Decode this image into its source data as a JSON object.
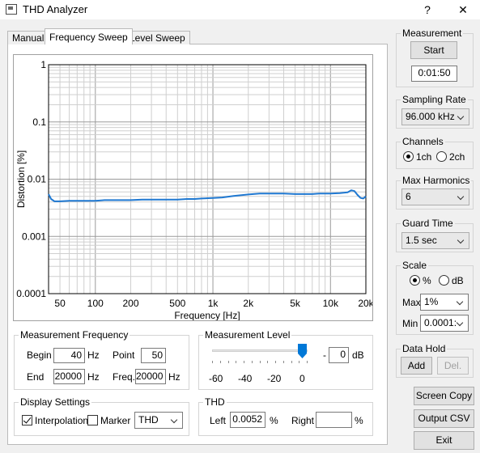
{
  "window": {
    "title": "THD Analyzer",
    "help_label": "?",
    "close_label": "✕"
  },
  "tabs": [
    {
      "label": "Manual",
      "active": false
    },
    {
      "label": "Frequency Sweep",
      "active": true
    },
    {
      "label": "Level Sweep",
      "active": false
    }
  ],
  "chart_data": {
    "type": "line",
    "xlabel": "Frequency [Hz]",
    "ylabel": "Distortion [%]",
    "x_scale": "log",
    "y_scale": "log",
    "xlim": [
      40,
      20000
    ],
    "ylim": [
      0.0001,
      1
    ],
    "grid": true,
    "x_ticks": [
      {
        "value": 50,
        "label": "50"
      },
      {
        "value": 100,
        "label": "100"
      },
      {
        "value": 200,
        "label": "200"
      },
      {
        "value": 500,
        "label": "500"
      },
      {
        "value": 1000,
        "label": "1k"
      },
      {
        "value": 2000,
        "label": "2k"
      },
      {
        "value": 5000,
        "label": "5k"
      },
      {
        "value": 10000,
        "label": "10k"
      },
      {
        "value": 20000,
        "label": "20k"
      }
    ],
    "y_ticks": [
      {
        "value": 1,
        "label": "1"
      },
      {
        "value": 0.1,
        "label": "0.1"
      },
      {
        "value": 0.01,
        "label": "0.01"
      },
      {
        "value": 0.001,
        "label": "0.001"
      },
      {
        "value": 0.0001,
        "label": "0.0001"
      }
    ],
    "series": [
      {
        "color": "#1f78d1",
        "x": [
          40,
          42,
          45,
          50,
          60,
          70,
          80,
          100,
          120,
          150,
          200,
          250,
          300,
          400,
          500,
          600,
          700,
          800,
          1000,
          1200,
          1500,
          2000,
          2500,
          3000,
          4000,
          5000,
          6000,
          7000,
          8000,
          10000,
          12000,
          14000,
          15000,
          16000,
          17000,
          18000,
          19000,
          20000
        ],
        "y": [
          0.0055,
          0.0045,
          0.0041,
          0.0041,
          0.0042,
          0.0042,
          0.0042,
          0.0042,
          0.0043,
          0.0043,
          0.0043,
          0.0044,
          0.0044,
          0.0044,
          0.0044,
          0.0045,
          0.0045,
          0.0046,
          0.0047,
          0.0048,
          0.0051,
          0.0054,
          0.0056,
          0.0056,
          0.0056,
          0.0055,
          0.0055,
          0.0055,
          0.0056,
          0.0056,
          0.0057,
          0.0059,
          0.0064,
          0.0062,
          0.0053,
          0.0047,
          0.0046,
          0.005
        ]
      }
    ]
  },
  "measurement_frequency": {
    "title": "Measurement Frequency",
    "begin_label": "Begin",
    "begin_value": "40",
    "begin_unit": "Hz",
    "end_label": "End",
    "end_value": "20000",
    "end_unit": "Hz",
    "point_label": "Point",
    "point_value": "50",
    "freq_label": "Freq.",
    "freq_value": "20000",
    "freq_unit": "Hz"
  },
  "measurement_level": {
    "title": "Measurement Level",
    "slider_labels": [
      "-60",
      "-40",
      "-20",
      "0"
    ],
    "slider_value_db": 0,
    "value_prefix": "-",
    "value": "0",
    "unit": "dB"
  },
  "display_settings": {
    "title": "Display Settings",
    "interpolation_label": "Interpolation",
    "interpolation_checked": true,
    "marker_label": "Marker",
    "marker_checked": false,
    "channel_select": "THD"
  },
  "thd": {
    "title": "THD",
    "left_label": "Left",
    "left_value": "0.0052",
    "left_unit": "%",
    "right_label": "Right",
    "right_value": "",
    "right_unit": "%"
  },
  "sidebar": {
    "measurement": {
      "title": "Measurement",
      "start_label": "Start",
      "elapsed": "0:01:50"
    },
    "sampling_rate": {
      "title": "Sampling Rate",
      "value": "96.000 kHz"
    },
    "channels": {
      "title": "Channels",
      "option1": "1ch",
      "option2": "2ch",
      "selected": "1ch"
    },
    "max_harmonics": {
      "title": "Max Harmonics",
      "value": "6"
    },
    "guard_time": {
      "title": "Guard Time",
      "value": "1.5 sec"
    },
    "scale": {
      "title": "Scale",
      "percent_label": "%",
      "db_label": "dB",
      "selected": "%",
      "max_label": "Max",
      "max_value": "1%",
      "min_label": "Min",
      "min_value": "0.0001:"
    },
    "data_hold": {
      "title": "Data Hold",
      "add_label": "Add",
      "del_label": "Del."
    },
    "screen_copy_label": "Screen Copy",
    "output_csv_label": "Output CSV",
    "exit_label": "Exit"
  }
}
